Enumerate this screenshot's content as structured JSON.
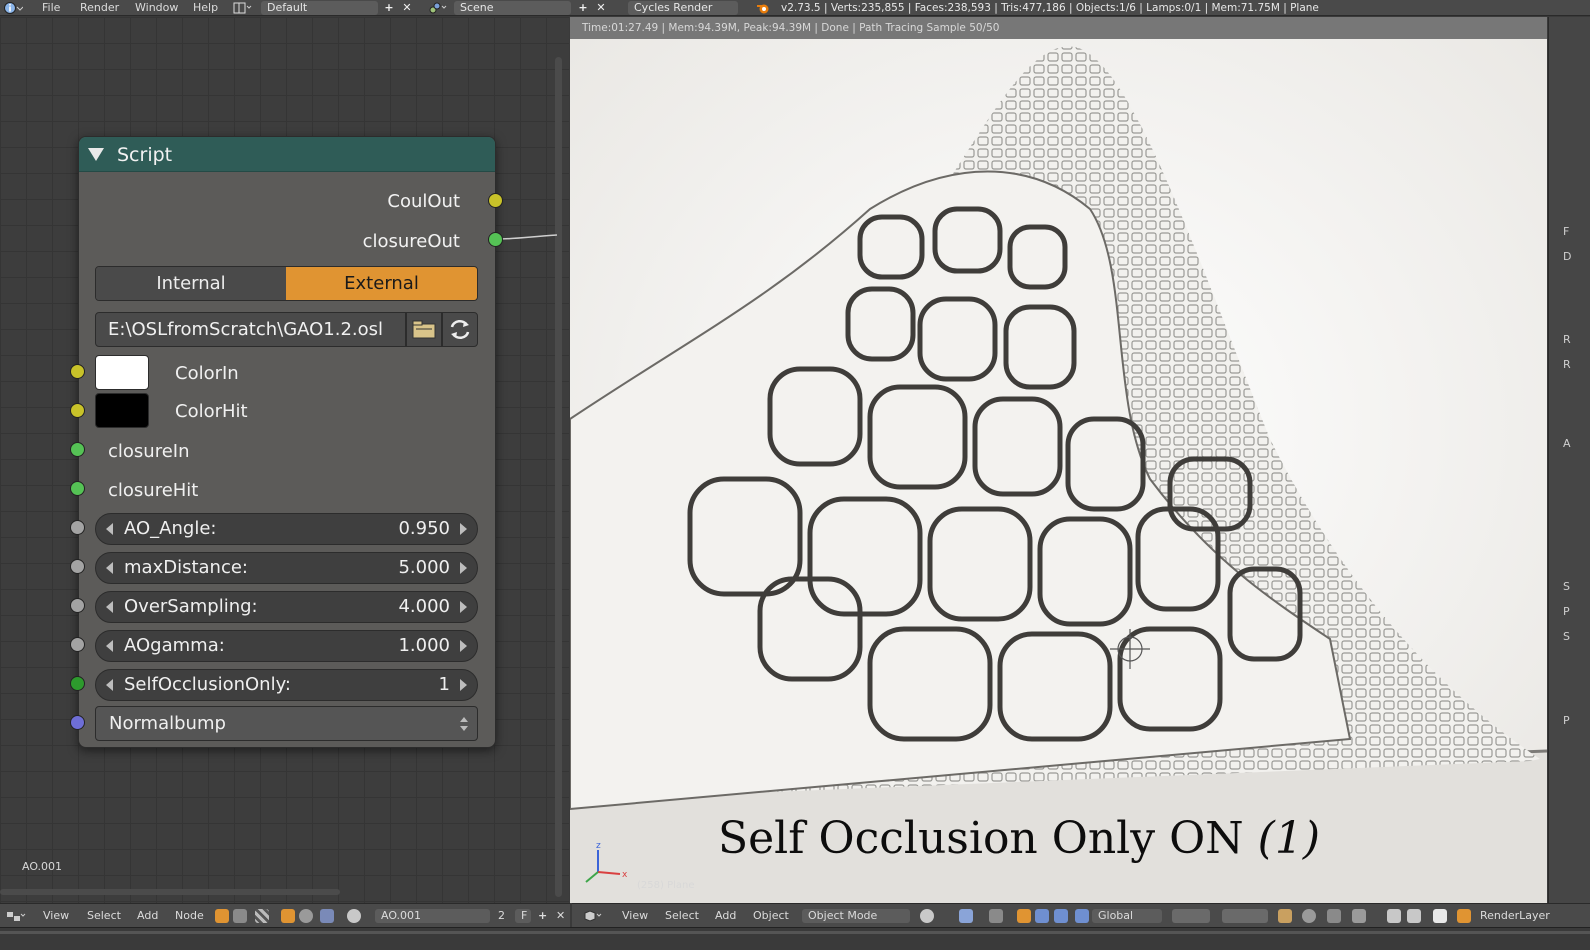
{
  "topbar": {
    "menus": [
      "File",
      "Render",
      "Window",
      "Help"
    ],
    "layout_name": "Default",
    "scene_name": "Scene",
    "render_engine": "Cycles Render",
    "stats": "v2.73.5 | Verts:235,855 | Faces:238,593 | Tris:477,186 | Objects:1/6 | Lamps:0/1 | Mem:71.75M | Plane"
  },
  "node_editor": {
    "node_tree_label": "AO.001",
    "node": {
      "title": "Script",
      "outputs": [
        "CoulOut",
        "closureOut"
      ],
      "mode_internal": "Internal",
      "mode_external": "External",
      "filepath": "E:\\OSLfromScratch\\GAO1.2.osl",
      "inputs": {
        "color_in": "ColorIn",
        "color_hit": "ColorHit",
        "closure_in": "closureIn",
        "closure_hit": "closureHit"
      },
      "sliders": [
        {
          "name": "AO_Angle:",
          "value": "0.950"
        },
        {
          "name": "maxDistance:",
          "value": "5.000"
        },
        {
          "name": "OverSampling:",
          "value": "4.000"
        },
        {
          "name": "AOgamma:",
          "value": "1.000"
        },
        {
          "name": "SelfOcclusionOnly:",
          "value": "1"
        }
      ],
      "normal_input": "Normalbump",
      "colors": {
        "color_in": "#ffffff",
        "color_hit": "#000000",
        "external_active": "#e09432"
      }
    }
  },
  "render_view": {
    "info": "Time:01:27.49 | Mem:94.39M, Peak:94.39M | Done | Path Tracing Sample 50/50",
    "caption_main": "Self Occlusion Only ON ",
    "caption_italic": "(1)",
    "frame_text": "(258) Plane",
    "axis_x": "x",
    "axis_z": "z"
  },
  "props_strip_letters": [
    "F",
    "D",
    "R",
    "R",
    "A",
    "S",
    "P",
    "S",
    "P"
  ],
  "bottom_node": {
    "menus": [
      "View",
      "Select",
      "Add",
      "Node"
    ],
    "node_tree": "AO.001",
    "users": "2",
    "fake_user": "F"
  },
  "bottom_view3d": {
    "menus": [
      "View",
      "Select",
      "Add",
      "Object"
    ],
    "mode": "Object Mode",
    "orientation": "Global",
    "render_layer": "RenderLayer"
  }
}
